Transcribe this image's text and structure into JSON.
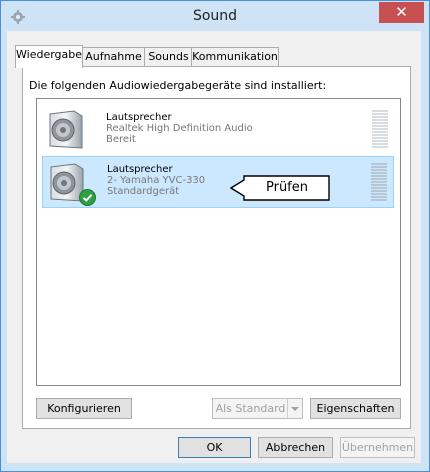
{
  "window": {
    "title": "Sound",
    "close_symbol": "✕",
    "app_icon": "speaker-settings-icon"
  },
  "tabs": [
    {
      "label": "Wiedergabe",
      "active": true
    },
    {
      "label": "Aufnahme",
      "active": false
    },
    {
      "label": "Sounds",
      "active": false
    },
    {
      "label": "Kommunikation",
      "active": false
    }
  ],
  "heading": "Die folgenden Audiowiedergabegeräte sind installiert:",
  "devices": [
    {
      "name": "Lautsprecher",
      "driver": "Realtek High Definition Audio",
      "status": "Bereit",
      "selected": false,
      "default": false,
      "icon": "speaker-icon"
    },
    {
      "name": "Lautsprecher",
      "driver": "2- Yamaha YVC-330",
      "status": "Standardgerät",
      "selected": true,
      "default": true,
      "icon": "speaker-icon",
      "badge_icon": "default-check-icon"
    }
  ],
  "callout": {
    "label": "Prüfen"
  },
  "buttons": {
    "configure": "Konfigurieren",
    "set_default": "Als Standard",
    "properties": "Eigenschaften",
    "ok": "OK",
    "cancel": "Abbrechen",
    "apply": "Übernehmen"
  },
  "colors": {
    "titlebar": "#cfe3f7",
    "close": "#c75050",
    "selection": "#cce8ff",
    "default_badge": "#2ea043"
  }
}
